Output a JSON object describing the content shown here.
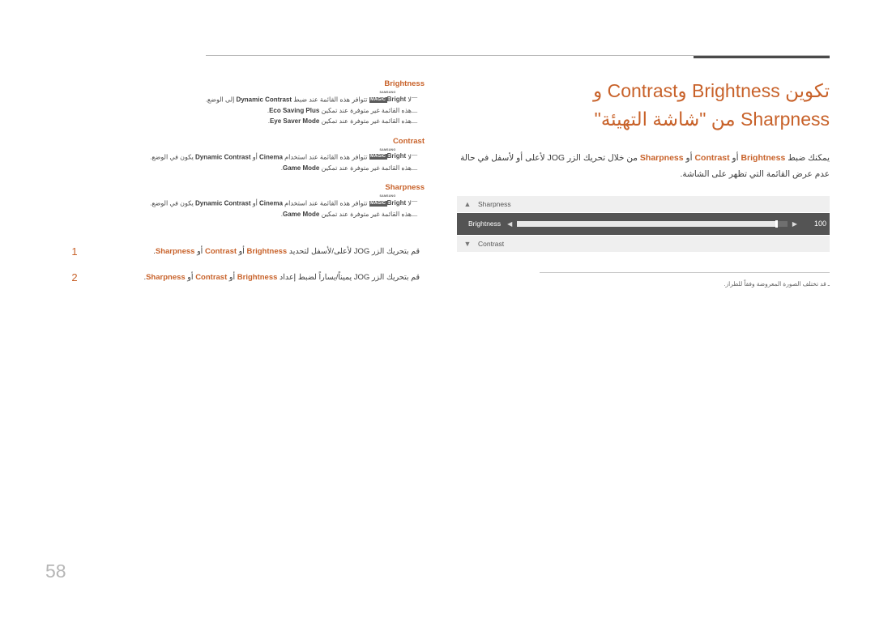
{
  "page": {
    "number": "58",
    "accent_color": "#c8622a"
  },
  "right": {
    "heading_line1": "تكوين Brightness وContrast و",
    "heading_line2": "Sharpness من \"شاشة التهيئة\"",
    "intro_prefix": "يمكنك ضبط ",
    "intro_b1": "Brightness",
    "intro_mid1": " أو ",
    "intro_b2": "Contrast",
    "intro_mid2": " أو ",
    "intro_b3": "Sharpness",
    "intro_suffix": " من خلال تحريك الزر JOG لأعلى أو لأسفل في حالة عدم عرض القائمة التي تظهر على الشاشة.",
    "note": "ـ قد تختلف الصورة المعروضة وفقاً للطراز."
  },
  "osd": {
    "rows": [
      {
        "icon": "chevron-up-icon",
        "label": "Sharpness",
        "type": "plain"
      },
      {
        "icon": "",
        "label": "Brightness",
        "type": "slider",
        "value": "100",
        "fill_percent": 96
      },
      {
        "icon": "chevron-down-icon",
        "label": "Contrast",
        "type": "plain"
      }
    ],
    "left_arrow": "◀",
    "right_arrow": "▶"
  },
  "spec_blocks": [
    {
      "title": "Brightness",
      "lines": [
        {
          "dash": "ـــ",
          "pre": "لا ",
          "badge": {
            "samsung": "SAMSUNG",
            "magic": "MAGIC",
            "word": "Bright"
          },
          "post": " تتوافر هذه القائمة عند ضبط ",
          "bold": "Dynamic Contrast",
          "tail": " إلى الوضع."
        },
        {
          "dash": "ـــ",
          "pre": "هذه القائمة غير متوفرة عند تمكين ",
          "bold": "Eco Saving Plus",
          "tail": ".",
          "simple": true
        },
        {
          "dash": "ـــ",
          "pre": "هذه القائمة غير متوفرة عند تمكين ",
          "bold": "Eye Saver Mode",
          "tail": ".",
          "simple": true
        }
      ]
    },
    {
      "title": "Contrast",
      "lines": [
        {
          "dash": "ـــ",
          "pre": "لا ",
          "badge": {
            "samsung": "SAMSUNG",
            "magic": "MAGIC",
            "word": "Bright"
          },
          "post": " تتوافر هذه القائمة عند استخدام ",
          "bold": "Cinema",
          "mid": " أو ",
          "bold2": "Dynamic Contrast",
          "tail": " يكون في الوضع."
        },
        {
          "dash": "ـــ",
          "pre": "هذه القائمة غير متوفرة عند تمكين ",
          "bold": "Game Mode",
          "tail": ".",
          "simple": true
        }
      ]
    },
    {
      "title": "Sharpness",
      "lines": [
        {
          "dash": "ـــ",
          "pre": "لا ",
          "badge": {
            "samsung": "SAMSUNG",
            "magic": "MAGIC",
            "word": "Bright"
          },
          "post": " تتوافر هذه القائمة عند استخدام ",
          "bold": "Cinema",
          "mid": " أو ",
          "bold2": "Dynamic Contrast",
          "tail": " يكون في الوضع."
        },
        {
          "dash": "ـــ",
          "pre": "هذه القائمة غير متوفرة عند تمكين ",
          "bold": "Game Mode",
          "tail": ".",
          "simple": true
        }
      ]
    }
  ],
  "steps": [
    {
      "num": "1",
      "prefix": "قم بتحريك الزر JOG لأعلى/لأسفل لتحديد ",
      "b1": "Brightness",
      "mid1": " أو ",
      "b2": "Contrast",
      "mid2": " أو ",
      "b3": "Sharpness",
      "suffix": "."
    },
    {
      "num": "2",
      "prefix": "قم بتحريك الزر JOG يميناً/يساراً لضبط إعداد ",
      "b1": "Brightness",
      "mid1": " أو ",
      "b2": "Contrast",
      "mid2": " أو ",
      "b3": "Sharpness",
      "suffix": "."
    }
  ]
}
